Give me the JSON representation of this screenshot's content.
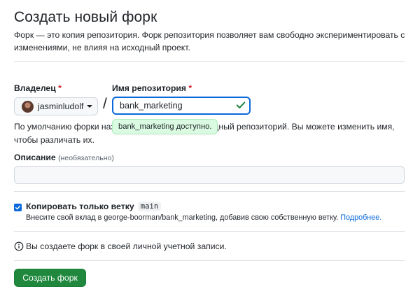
{
  "page": {
    "title": "Создать новый форк",
    "subtitle": "Форк — это копия репозитория. Форк репозитория позволяет вам свободно экспериментировать с изменениями, не влияя на исходный проект."
  },
  "form": {
    "owner_label": "Владелец",
    "repo_label": "Имя репозитория",
    "required_mark": "*",
    "owner_value": "jasminludolf",
    "slash": "/",
    "repo_value": "bank_marketing",
    "availability_tooltip": "bank_marketing доступно.",
    "help_text": "По умолчанию форки называются так же, как исходный репозиторий. Вы можете изменить имя, чтобы различать их.",
    "description_label": "Описание",
    "description_optional": "(необязательно)",
    "description_value": ""
  },
  "copy_branch": {
    "checked": true,
    "label": "Копировать только ветку",
    "branch": "main",
    "note_prefix": "Внесите свой вклад в george-boorman/bank_marketing, добавив свою собственную ветку.",
    "note_link": "Подробнее."
  },
  "info": {
    "text": "Вы создаете форк в своей личной учетной записи."
  },
  "actions": {
    "submit_label": "Создать форк"
  },
  "colors": {
    "primary_button": "#1f883d",
    "focus_border": "#0969da",
    "required": "#d1242f",
    "success_check": "#1a7f37",
    "tooltip_bg": "#dafbe1",
    "link": "#0969da"
  },
  "icons": {
    "owner_dropdown": "chevron-down-icon",
    "valid": "check-icon",
    "info": "info-icon",
    "checkbox": "checkbox-checked-icon"
  }
}
